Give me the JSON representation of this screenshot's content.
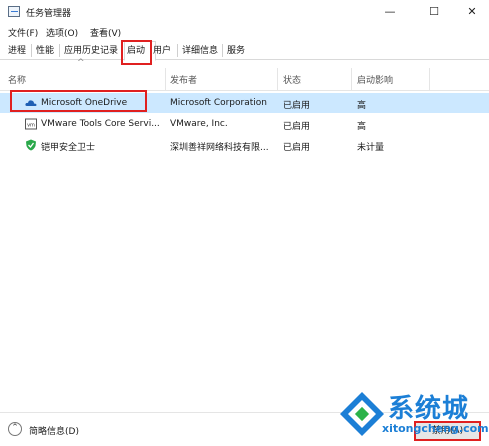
{
  "window": {
    "title": "任务管理器",
    "controls": {
      "minimize": "—",
      "maximize": "☐",
      "close": "✕"
    }
  },
  "menu": [
    "文件(F)",
    "选项(O)",
    "查看(V)"
  ],
  "tabs": [
    "进程",
    "性能",
    "应用历史记录",
    "启动",
    "用户",
    "详细信息",
    "服务"
  ],
  "active_tab": "启动",
  "columns": {
    "name": "名称",
    "publisher": "发布者",
    "status": "状态",
    "impact": "启动影响"
  },
  "rows": [
    {
      "name": "Microsoft OneDrive",
      "publisher": "Microsoft Corporation",
      "status": "已启用",
      "impact": "高",
      "icon": "onedrive-cloud-icon",
      "selected": true
    },
    {
      "name": "VMware Tools Core Servi...",
      "publisher": "VMware, Inc.",
      "status": "已启用",
      "impact": "高",
      "icon": "vmware-icon",
      "selected": false
    },
    {
      "name": "铠甲安全卫士",
      "publisher": "深圳善祥网络科技有限...",
      "status": "已启用",
      "impact": "未计量",
      "icon": "shield-icon",
      "selected": false
    }
  ],
  "footer": {
    "fewer_details": "简略信息(D)",
    "disable_button": "禁用(A)"
  },
  "watermark": {
    "brand": "系统城",
    "url": "xitongcheng.com"
  },
  "colors": {
    "highlight": "#e02020",
    "selection": "#cce8ff",
    "watermark": "#1c7fd6"
  }
}
